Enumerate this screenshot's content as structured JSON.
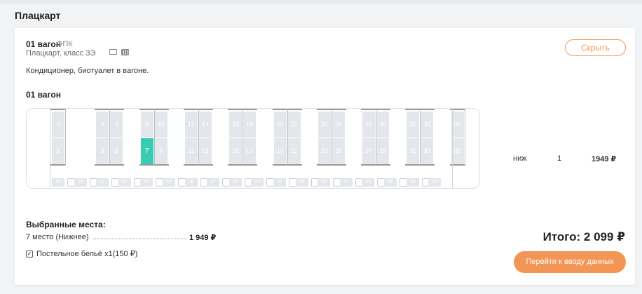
{
  "section": {
    "title": "Плацкарт"
  },
  "wagon": {
    "title": "01 вагон",
    "carrier": "ФПК",
    "class": "Плацкарт, класс 3Э",
    "features": "Кондиционер, биотуалет в вагоне.",
    "hide_label": "Скрыть",
    "services": [
      {
        "icon": "air-conditioner-icon"
      },
      {
        "icon": "toilet-icon"
      }
    ]
  },
  "map": {
    "title": "01 вагон",
    "compartments": [
      {
        "top": [
          "2",
          ""
        ],
        "bottom": [
          "1",
          ""
        ]
      },
      {
        "top": [
          "4",
          "6"
        ],
        "bottom": [
          "3",
          "5"
        ]
      },
      {
        "top": [
          "8",
          "10"
        ],
        "bottom": [
          "7",
          "9"
        ]
      },
      {
        "top": [
          "12",
          "14"
        ],
        "bottom": [
          "11",
          "13"
        ]
      },
      {
        "top": [
          "16",
          "18"
        ],
        "bottom": [
          "15",
          "17"
        ]
      },
      {
        "top": [
          "20",
          "22"
        ],
        "bottom": [
          "19",
          "21"
        ]
      },
      {
        "top": [
          "24",
          "26"
        ],
        "bottom": [
          "23",
          "25"
        ]
      },
      {
        "top": [
          "28",
          "30"
        ],
        "bottom": [
          "27",
          "29"
        ]
      },
      {
        "top": [
          "32",
          "34"
        ],
        "bottom": [
          "31",
          "33"
        ]
      },
      {
        "top": [
          "36",
          ""
        ],
        "bottom": [
          "35",
          ""
        ]
      }
    ],
    "side_seats": [
      "54",
      "53",
      "52",
      "51",
      "50",
      "49",
      "48",
      "47",
      "46",
      "45",
      "44",
      "43",
      "42",
      "41",
      "40",
      "39",
      "38",
      "37"
    ],
    "selected_seat": "7"
  },
  "price_row": {
    "type": "ниж",
    "count": "1",
    "price": "1949 ₽"
  },
  "selected": {
    "title": "Выбранные места:",
    "line": "7 место (Нижнее)",
    "price": "1 949 ₽",
    "bedding": "Постельное бельё x1(150 ₽)",
    "bedding_checked": true
  },
  "total": "Итого: 2 099 ₽",
  "continue_label": "Перейти к вводу данных",
  "colors": {
    "accent": "#f39655",
    "selected_seat": "#36cdb4",
    "seat": "#e3e6ea"
  }
}
